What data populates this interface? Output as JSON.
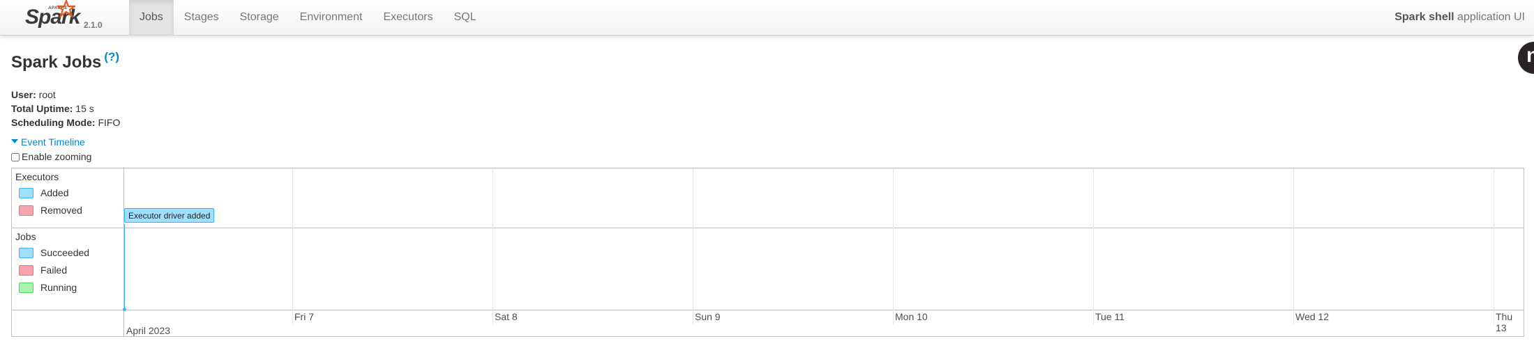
{
  "brand": {
    "apache": "APACHE",
    "name": "Spark",
    "version": "2.1.0"
  },
  "nav": {
    "items": [
      {
        "label": "Jobs",
        "active": true
      },
      {
        "label": "Stages"
      },
      {
        "label": "Storage"
      },
      {
        "label": "Environment"
      },
      {
        "label": "Executors"
      },
      {
        "label": "SQL"
      }
    ],
    "app_name": "Spark shell",
    "app_suffix": " application UI"
  },
  "avatar": {
    "letter": "n"
  },
  "page": {
    "title": "Spark Jobs",
    "help": "(?)",
    "info": [
      {
        "label": "User:",
        "value": " root"
      },
      {
        "label": "Total Uptime:",
        "value": " 15 s"
      },
      {
        "label": "Scheduling Mode:",
        "value": " FIFO"
      }
    ]
  },
  "timeline": {
    "toggle_label": "Event Timeline",
    "zoom_label": "Enable zooming",
    "executors": {
      "title": "Executors",
      "legend": [
        "Added",
        "Removed"
      ]
    },
    "jobs": {
      "title": "Jobs",
      "legend": [
        "Succeeded",
        "Failed",
        "Running"
      ]
    },
    "event_label": "Executor driver added",
    "axis_days": [
      "Fri 7",
      "Sat 8",
      "Sun 9",
      "Mon 10",
      "Tue 11",
      "Wed 12",
      "Thu 13"
    ],
    "axis_month": "April 2023"
  },
  "colors": {
    "accent": "#0088cc",
    "executor_added": "#a0dffe",
    "removed_failed": "#f9a3af",
    "running": "#a4f5ae"
  }
}
